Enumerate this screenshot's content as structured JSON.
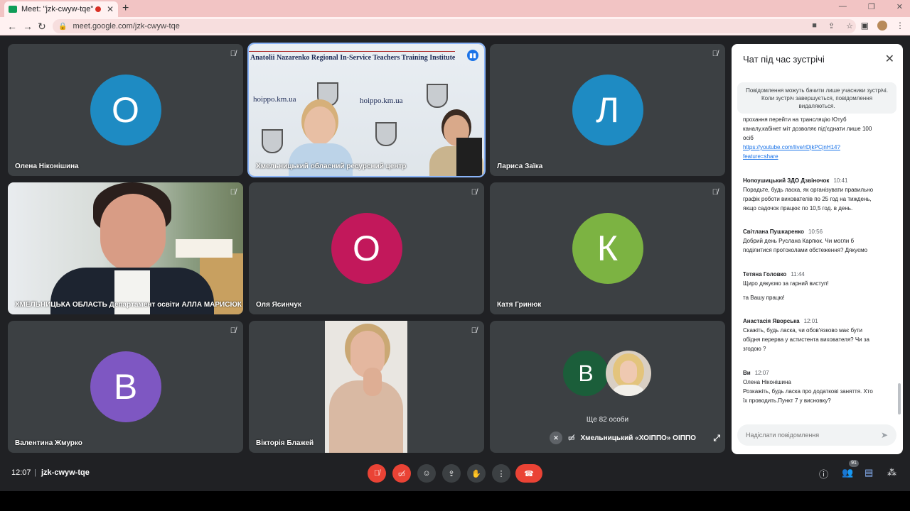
{
  "browser": {
    "tab_title": "Meet: \"jzk-cwyw-tqe\"",
    "tab_close": "✕",
    "new_tab": "+",
    "url": "meet.google.com/jzk-cwyw-tqe",
    "win_minimize": "—",
    "win_restore": "❐",
    "win_close": "✕"
  },
  "tiles": [
    {
      "name": "Олена Ніконішина",
      "initial": "О",
      "color": "#1e8bc3"
    },
    {
      "name": "Хмельницький обласний ресурсний центр",
      "banner": "Anatolii Nazarenko Regional In-Service Teachers Training Institute",
      "site1": "hoippo.km.ua",
      "site2": "hoippo.km.ua"
    },
    {
      "name": "Лариса Заїка",
      "initial": "Л",
      "color": "#1e8bc3"
    },
    {
      "name": "ХМЕЛЬНИЦЬКА ОБЛАСТЬ Департамент освіти АЛЛА МАРИСЮК"
    },
    {
      "name": "Оля Ясинчук",
      "initial": "О",
      "color": "#c2185b"
    },
    {
      "name": "Катя Гринюк",
      "initial": "К",
      "color": "#7cb342"
    },
    {
      "name": "Валентина Жмурко",
      "initial": "В",
      "color": "#7e57c2"
    },
    {
      "name": "Вікторія Блажей"
    },
    {
      "more_initial": "В",
      "more_color": "#1b5e3a",
      "more_label": "Ще 82 особи",
      "name": "Хмельницький «ХОІППО» ОІППО"
    }
  ],
  "chat": {
    "title": "Чат під час зустрічі",
    "notice": "Повідомлення можуть бачити лише учасники зустрічі. Коли зустріч завершується, повідомлення видаляються.",
    "messages": [
      {
        "sender": "",
        "time": "",
        "lines": [
          "прохання перейти на трансляцію Ютуб",
          "каналу,кабінет міт дозволяє під'єднати лише 100",
          "осіб"
        ],
        "link": "https://youtube.com/live/rDjkPCjnH14?",
        "link2": "feature=share"
      },
      {
        "sender": "Нопоушицький ЗДО Дзвіночок",
        "time": "10:41",
        "lines": [
          "Порадьте, будь ласка, як організувати правильно",
          "графік роботи вихователів по 25 год на тиждень,",
          "якщо садочок працює по 10,5 год. в день."
        ]
      },
      {
        "sender": "Світлана Пушкаренко",
        "time": "10:56",
        "lines": [
          "Добрий день Руслана Карпюк. Чи могли б",
          "поділитися протоколами обстеження? Дякуємо"
        ]
      },
      {
        "sender": "Тетяна Головко",
        "time": "11:44",
        "lines": [
          "Щиро дякуємо за гарний виступ!"
        ],
        "extra": "та Вашу працю!"
      },
      {
        "sender": "Анастасія Яворська",
        "time": "12:01",
        "lines": [
          "Скажіть, будь ласка, чи обов'язково має бути",
          "обідня перерва у астистента вихователя? Чи за",
          "згодою ?"
        ]
      },
      {
        "sender": "Ви",
        "time": "12:07",
        "lines": [
          "Олена Ніконішина",
          "Розкажіть, будь ласка про додаткові заняття. Хто",
          "їх проводить.Пункт 7 у висновку?"
        ]
      }
    ],
    "input_placeholder": "Надіслати повідомлення"
  },
  "bottom": {
    "time": "12:07",
    "separator": "|",
    "meeting_code": "jzk-cwyw-tqe",
    "participants_count": "91"
  },
  "colors": {
    "background": "#202124",
    "tile": "#3c4043",
    "danger": "#ea4335",
    "accent": "#1a73e8"
  },
  "icons": {
    "mic_off": "mic-off-icon",
    "cam_off": "camera-off-icon",
    "captions": "captions-icon",
    "present": "present-icon",
    "hand": "raise-hand-icon",
    "more": "more-options-icon",
    "hangup": "hang-up-icon",
    "info": "info-icon",
    "people": "people-icon",
    "chat": "chat-icon",
    "activities": "activities-icon"
  }
}
